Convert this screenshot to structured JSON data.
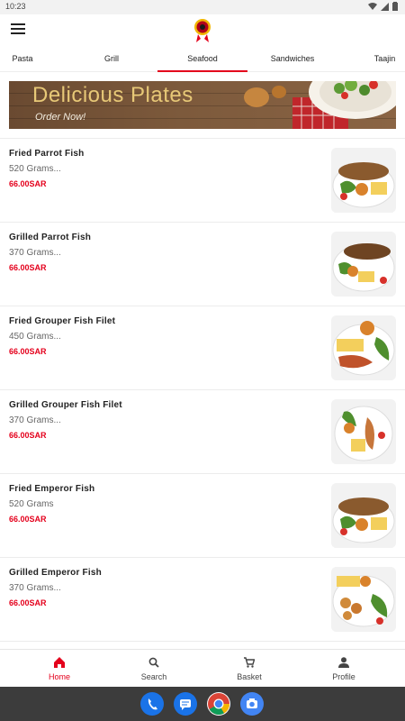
{
  "status_bar": {
    "time": "10:23",
    "icons": [
      "wifi-icon",
      "signal-icon",
      "battery-icon"
    ]
  },
  "app_bar": {
    "menu_icon": "hamburger-menu-icon",
    "logo": "restaurant-logo"
  },
  "tabs": [
    {
      "label": "Pasta",
      "active": false
    },
    {
      "label": "Grill",
      "active": false
    },
    {
      "label": "Seafood",
      "active": true
    },
    {
      "label": "Sandwiches",
      "active": false
    },
    {
      "label": "Taajin",
      "active": false
    }
  ],
  "banner": {
    "title": "Delicious Plates",
    "subtitle": "Order Now!"
  },
  "items": [
    {
      "name": "Fried Parrot Fish",
      "desc": "520 Grams...",
      "price": "66.00SAR"
    },
    {
      "name": "Grilled Parrot Fish",
      "desc": "370 Grams...",
      "price": "66.00SAR"
    },
    {
      "name": "Fried Grouper Fish Filet",
      "desc": "450 Grams...",
      "price": "66.00SAR"
    },
    {
      "name": "Grilled Grouper Fish Filet",
      "desc": "370 Grams...",
      "price": "66.00SAR"
    },
    {
      "name": "Fried Emperor Fish",
      "desc": "520 Grams",
      "price": "66.00SAR"
    },
    {
      "name": "Grilled Emperor Fish",
      "desc": "370 Grams...",
      "price": "66.00SAR"
    }
  ],
  "bottom_nav": [
    {
      "label": "Home",
      "icon": "home-icon",
      "active": true
    },
    {
      "label": "Search",
      "icon": "search-icon",
      "active": false
    },
    {
      "label": "Basket",
      "icon": "basket-icon",
      "active": false
    },
    {
      "label": "Profile",
      "icon": "profile-icon",
      "active": false
    }
  ],
  "dock": [
    "phone-icon",
    "messages-icon",
    "chrome-icon",
    "camera-icon"
  ],
  "colors": {
    "accent": "#e4001c",
    "background": "#ffffff",
    "system_bar": "#3c3c3c"
  }
}
